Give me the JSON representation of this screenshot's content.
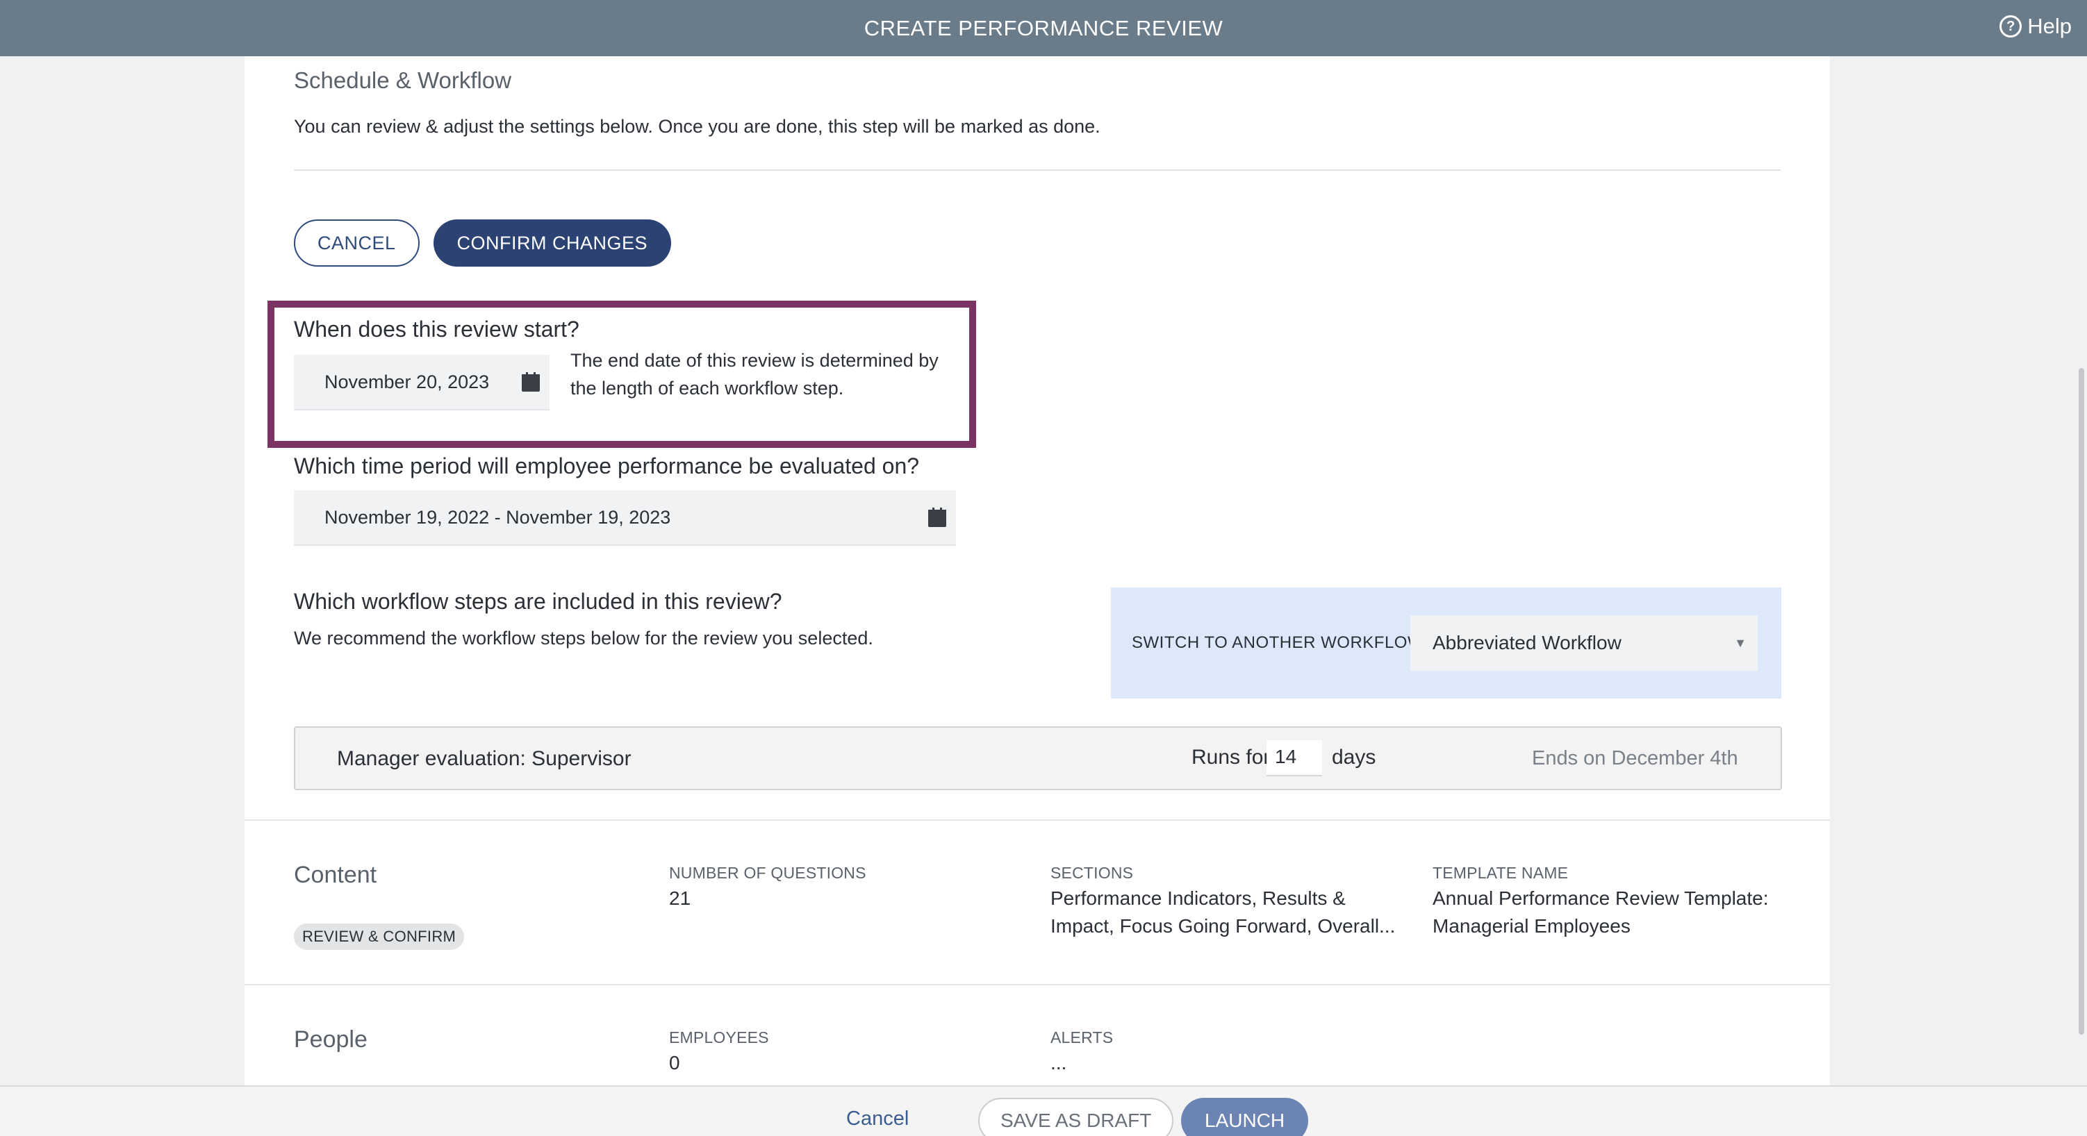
{
  "topbar": {
    "title": "CREATE PERFORMANCE REVIEW",
    "help_label": "Help",
    "help_icon": "?"
  },
  "schedule": {
    "section_title": "Schedule & Workflow",
    "intro": "You can review & adjust the settings below. Once you are done, this step will be marked as done.",
    "cancel_label": "CANCEL",
    "confirm_label": "CONFIRM CHANGES",
    "start_question": "When does this review start?",
    "start_date": "November 20, 2023",
    "end_hint": "The end date of this review is determined by the length of each workflow step.",
    "period_question": "Which time period will employee performance be evaluated on?",
    "period_value": "November 19, 2022 - November 19, 2023",
    "workflow_question": "Which workflow steps are included in this review?",
    "workflow_note": "We recommend the workflow steps below for the review you selected.",
    "switch_label": "SWITCH TO ANOTHER WORKFLOW",
    "workflow_selected": "Abbreviated Workflow",
    "step": {
      "name": "Manager evaluation: Supervisor",
      "runs_for": "Runs for",
      "days_value": "14",
      "days_label": "days",
      "ends_on": "Ends on December 4th"
    }
  },
  "content": {
    "title": "Content",
    "badge": "REVIEW & CONFIRM",
    "num_questions_label": "NUMBER OF QUESTIONS",
    "num_questions_value": "21",
    "sections_label": "SECTIONS",
    "sections_value": "Performance Indicators, Results & Impact, Focus Going Forward, Overall...",
    "template_label": "TEMPLATE NAME",
    "template_value": "Annual Performance Review Template: Managerial Employees"
  },
  "people": {
    "title": "People",
    "employees_label": "EMPLOYEES",
    "employees_value": "0",
    "alerts_label": "ALERTS",
    "alerts_value": "..."
  },
  "footer": {
    "cancel_label": "Cancel",
    "draft_label": "SAVE AS DRAFT",
    "launch_label": "LAUNCH"
  },
  "colors": {
    "topbar": "#6a7c89",
    "primary": "#2b4272",
    "highlight": "#7b3364",
    "switch_panel": "#dde9fb"
  }
}
